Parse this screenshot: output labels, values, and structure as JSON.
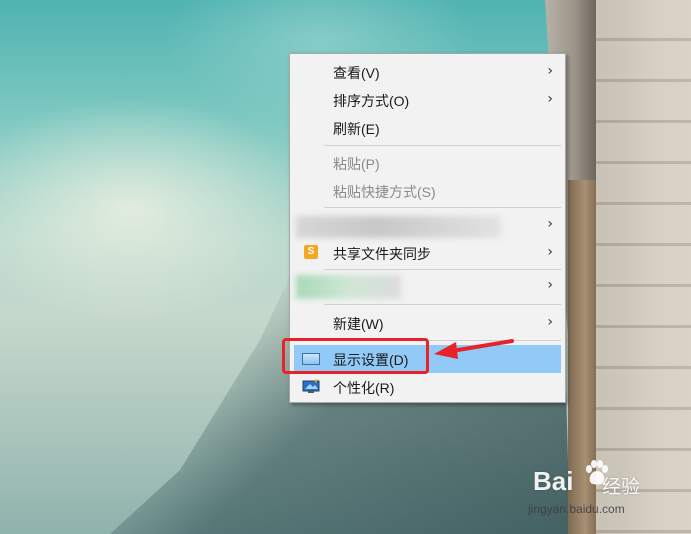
{
  "context_menu": {
    "items": [
      {
        "id": "view",
        "label": "查看(V)",
        "submenu": true
      },
      {
        "id": "sort",
        "label": "排序方式(O)",
        "submenu": true
      },
      {
        "id": "refresh",
        "label": "刷新(E)",
        "submenu": false
      },
      {
        "id": "paste",
        "label": "粘贴(P)",
        "disabled": true
      },
      {
        "id": "paste_shortcut",
        "label": "粘贴快捷方式(S)",
        "disabled": true
      },
      {
        "id": "redacted_1",
        "label": "",
        "submenu": true
      },
      {
        "id": "share_sync",
        "label": "共享文件夹同步",
        "submenu": true,
        "icon": "sync-s-icon",
        "icon_letter": "S"
      },
      {
        "id": "redacted_2",
        "label": "",
        "submenu": true
      },
      {
        "id": "new",
        "label": "新建(W)",
        "submenu": true
      },
      {
        "id": "display_settings",
        "label": "显示设置(D)",
        "highlighted": true,
        "icon": "display-icon"
      },
      {
        "id": "personalize",
        "label": "个性化(R)",
        "icon": "personalize-icon"
      }
    ],
    "chevron": "›"
  },
  "annotation": {
    "color": "#e8222a"
  },
  "watermark": {
    "brand": "Bai",
    "sub": "经验",
    "url": "jingyan.baidu.com"
  },
  "colors": {
    "highlight": "#91c9f7",
    "menu_bg": "#f2f2f2"
  }
}
